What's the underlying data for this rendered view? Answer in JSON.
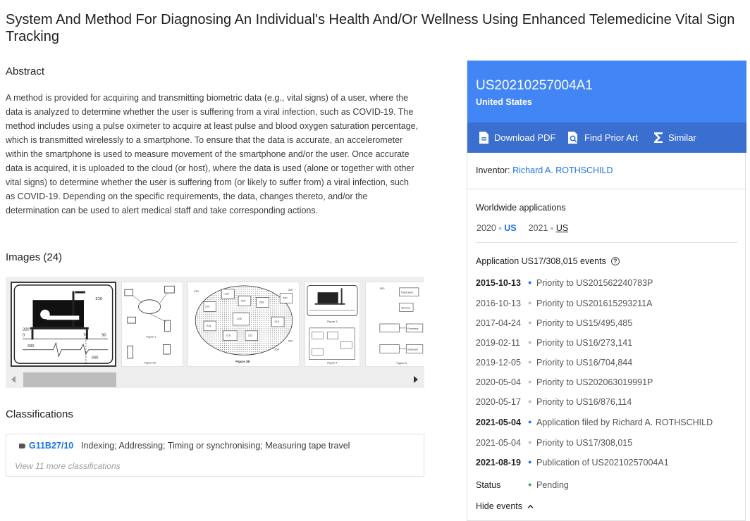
{
  "title": "System And Method For Diagnosing An Individual's Health And/Or Wellness Using Enhanced Telemedicine Vital Sign Tracking",
  "abstract": {
    "heading": "Abstract",
    "text": "A method is provided for acquiring and transmitting biometric data (e.g., vital signs) of a user, where the data is analyzed to determine whether the user is suffering from a viral infection, such as COVID-19. The method includes using a pulse oximeter to acquire at least pulse and blood oxygen saturation percentage, which is transmitted wirelessly to a smartphone. To ensure that the data is accurate, an accelerometer within the smartphone is used to measure movement of the smartphone and/or the user. Once accurate data is acquired, it is uploaded to the cloud (or host), where the data is used (alone or together with other vital signs) to determine whether the user is suffering from (or likely to suffer from) a viral infection, such as COVID-19. Depending on the specific requirements, the data, changes thereto, and/or the determination can be used to alert medical staff and take corresponding actions."
  },
  "images": {
    "heading": "Images (24)",
    "thumb1": {
      "labels": [
        "310",
        "320",
        "0",
        "70",
        "90",
        "330",
        "340"
      ]
    },
    "thumb2": {
      "labels": [
        "Figure 1",
        "Figure 3A"
      ]
    },
    "thumb3": {
      "labels": [
        "200",
        "230",
        "210",
        "202",
        "204",
        "206",
        "208",
        "214",
        "216",
        "212",
        "218",
        "220",
        "240",
        "250",
        "Figure 2B"
      ]
    },
    "thumb4": {
      "labels": [
        "Figure 3",
        "Figure 4"
      ]
    },
    "thumb5": {
      "labels": [
        "500",
        "Transceiver",
        "Memory",
        "Processor",
        "Keyboard",
        "Figure 5"
      ]
    }
  },
  "classifications": {
    "heading": "Classifications",
    "code": "G11B27/10",
    "description": "Indexing; Addressing; Timing or synchronising; Measuring tape travel",
    "more": "View 11 more classifications"
  },
  "panel": {
    "pub_number": "US20210257004A1",
    "country": "United States",
    "actions": {
      "download": "Download PDF",
      "prior_art": "Find Prior Art",
      "similar": "Similar"
    },
    "inventor_label": "Inventor:",
    "inventor_name": "Richard A. ROTHSCHILD",
    "worldwide_heading": "Worldwide applications",
    "worldwide": [
      {
        "year": "2020",
        "country": "US"
      },
      {
        "year": "2021",
        "country": "US"
      }
    ],
    "app_events_heading": "Application US17/308,015 events",
    "events": [
      {
        "date": "2015-10-13",
        "text": "Priority to US201562240783P",
        "key": true
      },
      {
        "date": "2016-10-13",
        "text": "Priority to US201615293211A",
        "key": false
      },
      {
        "date": "2017-04-24",
        "text": "Priority to US15/495,485",
        "key": false
      },
      {
        "date": "2019-02-11",
        "text": "Priority to US16/273,141",
        "key": false
      },
      {
        "date": "2019-12-05",
        "text": "Priority to US16/704,844",
        "key": false
      },
      {
        "date": "2020-05-04",
        "text": "Priority to US202063019991P",
        "key": false
      },
      {
        "date": "2020-05-17",
        "text": "Priority to US16/876,114",
        "key": false
      },
      {
        "date": "2021-05-04",
        "text": "Application filed by Richard A. ROTHSCHILD",
        "key": true
      },
      {
        "date": "2021-05-04",
        "text": "Priority to US17/308,015",
        "key": false
      },
      {
        "date": "2021-08-19",
        "text": "Publication of US20210257004A1",
        "key": true
      }
    ],
    "status_label": "Status",
    "status_value": "Pending",
    "hide_events": "Hide events"
  },
  "colors": {
    "accent": "#4285f4",
    "accent_dark": "#3b6fcf",
    "link": "#1a73e8",
    "status": "#34a853"
  }
}
